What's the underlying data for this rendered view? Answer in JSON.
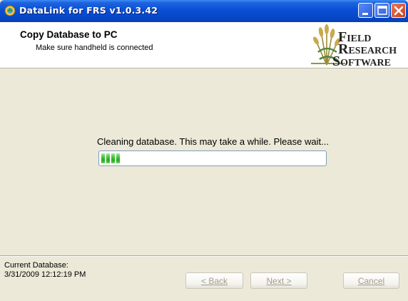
{
  "window": {
    "title": "DataLink for FRS v1.0.3.42",
    "app_icon": "app-icon",
    "controls": [
      "minimize-icon",
      "maximize-icon",
      "close-icon"
    ]
  },
  "header": {
    "title": "Copy Database to PC",
    "subtitle": "Make sure handheld is connected",
    "logo": {
      "line1_initial": "F",
      "line1_rest": "IELD",
      "line2_initial": "R",
      "line2_rest": "ESEARCH",
      "line3_initial": "S",
      "line3_rest": "OFTWARE"
    }
  },
  "main": {
    "status": "Cleaning database. This may take a while. Please wait...",
    "progress_fraction": 0.08
  },
  "footer": {
    "label": "Current Database:",
    "value": "3/31/2009 12:12:19 PM",
    "buttons": {
      "back": "< Back",
      "next": "Next >",
      "cancel": "Cancel"
    }
  },
  "colors": {
    "titlebar": "#0A4FD4",
    "window_bg": "#ECE9D8",
    "progress_green": "#3FC43A",
    "disabled_text": "#A19E8C"
  }
}
